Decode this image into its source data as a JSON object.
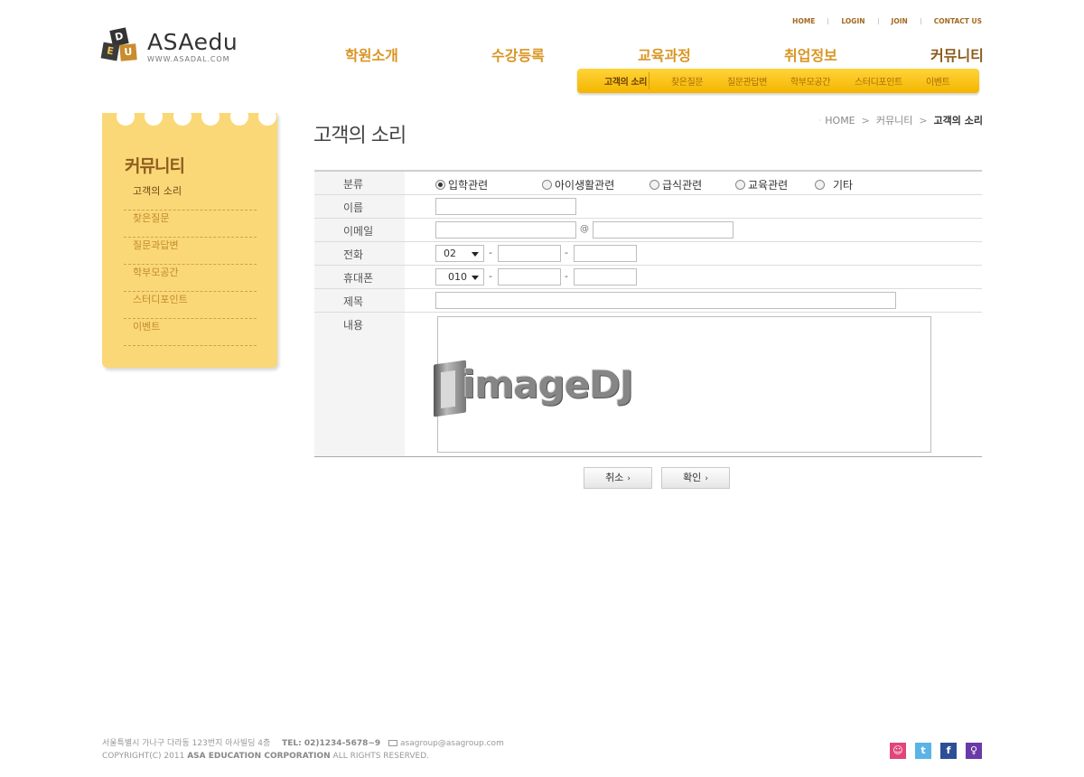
{
  "logo": {
    "cubes": [
      "D",
      "E",
      "U"
    ],
    "brand": "ASAedu",
    "url": "WWW.ASADAL.COM"
  },
  "util_links": [
    "HOME",
    "LOGIN",
    "JOIN",
    "CONTACT US"
  ],
  "gnb": [
    "학원소개",
    "수강등록",
    "교육과정",
    "취업정보",
    "커뮤니티"
  ],
  "subnav": [
    "고객의 소리",
    "찾은질문",
    "질문관답변",
    "학부모공간",
    "스터디포인트",
    "이벤트"
  ],
  "sidebar": {
    "title": "커뮤니티",
    "items": [
      "고객의 소리",
      "찾은질문",
      "질문과답변",
      "학부모공간",
      "스터디포인트",
      "이벤트"
    ]
  },
  "page_title": "고객의 소리",
  "breadcrumb": {
    "home": "HOME",
    "parent": "커뮤니티",
    "current": "고객의 소리"
  },
  "form": {
    "labels": {
      "category": "분류",
      "name": "이름",
      "email": "이메일",
      "phone": "전화",
      "mobile": "휴대폰",
      "subject": "제목",
      "content": "내용"
    },
    "category_options": [
      "입학관련",
      "아이생활관련",
      "급식관련",
      "교육관련",
      "기타"
    ],
    "category_selected": "입학관련",
    "email_at": "@",
    "phone_prefix": "02",
    "mobile_prefix": "010",
    "separator": "-"
  },
  "watermark_text": "imageDJ",
  "buttons": {
    "cancel": "취소",
    "confirm": "확인",
    "arrow": "›"
  },
  "footer": {
    "address": "서울특별시 가나구 다라동 123번지 아사빌딩 4층",
    "tel": "TEL: 02)1234-5678~9",
    "email": "asagroup@asagroup.com",
    "copyright_prefix": "COPYRIGHT(C) 2011",
    "company": "ASA EDUCATION CORPORATION",
    "copyright_suffix": "ALL RIGHTS RESERVED."
  },
  "sns": [
    {
      "icon": "blog-icon",
      "glyph": "☺",
      "color": "#e0457b"
    },
    {
      "icon": "twitter-icon",
      "glyph": "t",
      "color": "#5ab4e5"
    },
    {
      "icon": "facebook-icon",
      "glyph": "f",
      "color": "#2d4f96"
    },
    {
      "icon": "me2day-icon",
      "glyph": "♀",
      "color": "#6a3aa7"
    }
  ]
}
